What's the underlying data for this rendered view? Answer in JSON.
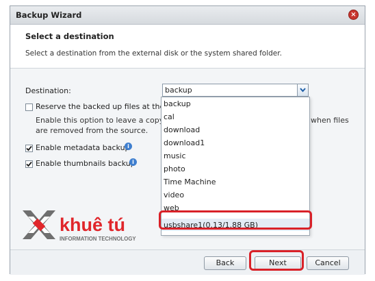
{
  "window": {
    "title": "Backup Wizard"
  },
  "header": {
    "title": "Select a destination",
    "description": "Select a destination from the external disk or the system shared folder."
  },
  "form": {
    "destination_label": "Destination:",
    "destination_value": "backup",
    "reserve_label": "Reserve the backed up files at the d",
    "reserve_checked": false,
    "reserve_help_line1": "Enable this option to leave a copy o",
    "reserve_help_line1_tail": "when files",
    "reserve_help_line2": "are removed from the source.",
    "metadata_label": "Enable metadata backup",
    "metadata_checked": true,
    "thumbnails_label": "Enable thumbnails backup",
    "thumbnails_checked": true
  },
  "dropdown": {
    "options": [
      "backup",
      "cal",
      "download",
      "download1",
      "music",
      "photo",
      "Time Machine",
      "video",
      "web",
      "usbshare1(0.13/1.88 GB)"
    ],
    "highlighted": "usbshare1(0.13/1.88 GB)"
  },
  "footer": {
    "back_label": "Back",
    "next_label": "Next",
    "cancel_label": "Cancel"
  },
  "watermark": {
    "brand": "khuê tú",
    "tagline": "INFORMATION TECHNOLOGY"
  },
  "colors": {
    "highlight_red": "#d92128",
    "close_red": "#c8352e",
    "info_blue": "#3f7fcf",
    "logo_red": "#e0262b",
    "logo_gray": "#6f6f6f"
  },
  "icons": {
    "close": "close-icon",
    "dropdown": "chevron-down-icon",
    "info": "info-icon",
    "check": "checkmark-icon"
  }
}
